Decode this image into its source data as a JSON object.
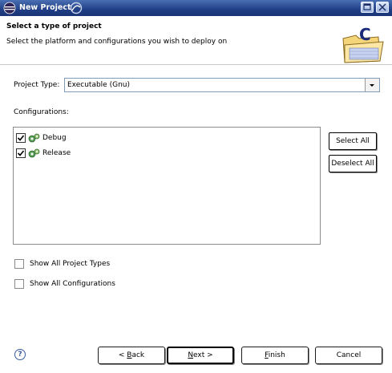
{
  "window": {
    "title": "New Project"
  },
  "header": {
    "title": "Select a type of project",
    "description": "Select the platform and configurations you wish to deploy on"
  },
  "project_type": {
    "label": "Project Type:",
    "value": "Executable (Gnu)"
  },
  "configurations": {
    "label": "Configurations:",
    "items": [
      {
        "label": "Debug",
        "checked": true
      },
      {
        "label": "Release",
        "checked": true
      }
    ],
    "select_all": "Select All",
    "deselect_all": "Deselect All"
  },
  "options": {
    "show_all_types": "Show All Project Types",
    "show_all_configs": "Show All Configurations"
  },
  "buttons": {
    "back_pre": "< ",
    "back_u": "B",
    "back_post": "ack",
    "next_u": "N",
    "next_post": "ext >",
    "finish_u": "F",
    "finish_post": "inish",
    "cancel": "Cancel"
  },
  "help": {
    "glyph": "?"
  }
}
